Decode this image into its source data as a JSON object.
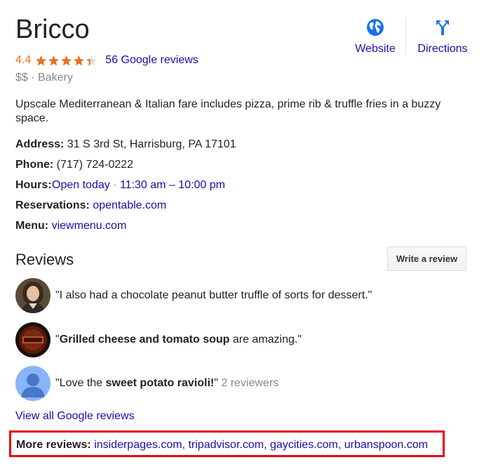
{
  "place": {
    "name": "Bricco",
    "rating": "4.4",
    "stars_value": 4.4,
    "reviews_link": "56 Google reviews",
    "price": "$$",
    "separator": " · ",
    "category": "Bakery",
    "description": "Upscale Mediterranean & Italian fare includes pizza, prime rib & truffle fries in a buzzy space."
  },
  "actions": {
    "website": {
      "label": "Website",
      "icon": "globe-icon"
    },
    "directions": {
      "label": "Directions",
      "icon": "directions-icon"
    }
  },
  "facts": {
    "address": {
      "label": "Address:",
      "value": " 31 S 3rd St, Harrisburg, PA 17101"
    },
    "phone": {
      "label": "Phone:",
      "value": " (717) 724-0222"
    },
    "hours": {
      "label": "Hours:",
      "status": "Open today",
      "sep": " · ",
      "range": "11:30 am – 10:00 pm"
    },
    "reservations": {
      "label": "Reservations:",
      "link": "opentable.com"
    },
    "menu": {
      "label": "Menu:",
      "link": "viewmenu.com"
    }
  },
  "reviews": {
    "heading": "Reviews",
    "write_button": "Write a review",
    "items": [
      {
        "pre": "\"I also had a chocolate peanut butter truffle of sorts for dessert.\"",
        "bold": "",
        "post": "",
        "extra": ""
      },
      {
        "pre": "\"",
        "bold": "Grilled cheese and tomato soup",
        "post": " are amazing.\"",
        "extra": ""
      },
      {
        "pre": "\"Love the ",
        "bold": "sweet potato ravioli!",
        "post": "\"",
        "extra": " 2 reviewers"
      }
    ],
    "view_all": "View all Google reviews",
    "more_label": "More reviews:",
    "more_links": [
      "insiderpages.com",
      "tripadvisor.com",
      "gaycities.com",
      "urbanspoon.com"
    ],
    "more_sep": ", "
  },
  "colors": {
    "link": "#1a0dab",
    "rating": "#e7711b",
    "highlight_box": "#e8000d"
  }
}
